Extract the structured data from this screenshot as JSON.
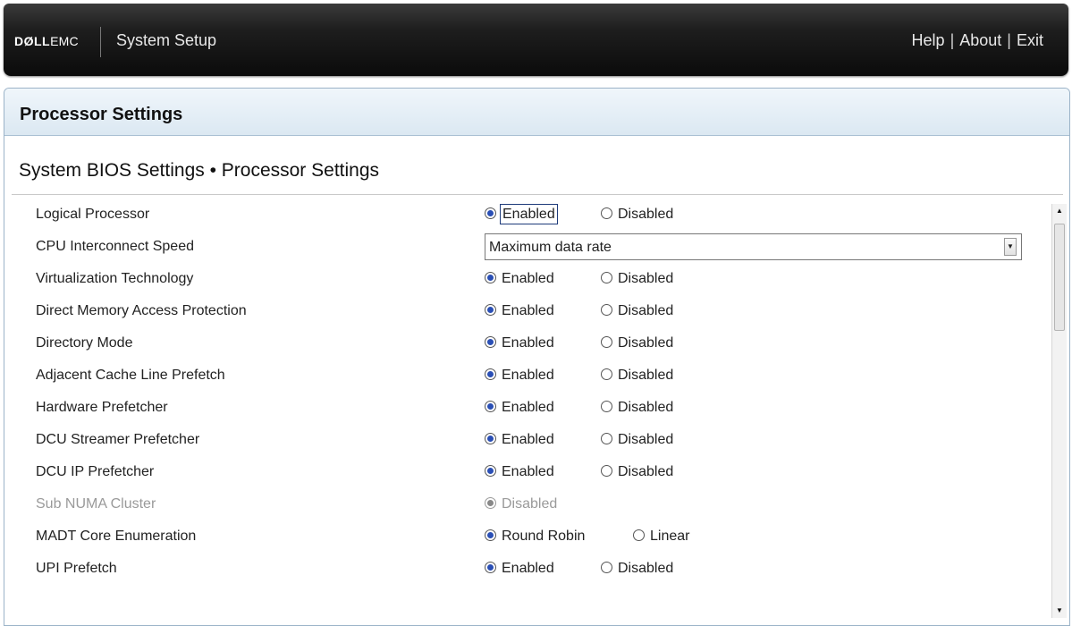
{
  "header": {
    "brand_dell": "DØLL",
    "brand_emc": "EMC",
    "app_title": "System Setup",
    "links": [
      "Help",
      "About",
      "Exit"
    ],
    "separator": "|"
  },
  "page": {
    "title": "Processor Settings",
    "breadcrumb": "System BIOS Settings • Processor Settings"
  },
  "settings": [
    {
      "label": "Logical Processor",
      "options": [
        "Enabled",
        "Disabled"
      ],
      "selected": "Enabled",
      "focused": true
    },
    {
      "label": "CPU Interconnect Speed",
      "dropdown_value": "Maximum data rate"
    },
    {
      "label": "Virtualization Technology",
      "options": [
        "Enabled",
        "Disabled"
      ],
      "selected": "Enabled"
    },
    {
      "label": "Direct Memory Access Protection",
      "options": [
        "Enabled",
        "Disabled"
      ],
      "selected": "Enabled"
    },
    {
      "label": "Directory Mode",
      "options": [
        "Enabled",
        "Disabled"
      ],
      "selected": "Enabled"
    },
    {
      "label": "Adjacent Cache Line Prefetch",
      "options": [
        "Enabled",
        "Disabled"
      ],
      "selected": "Enabled"
    },
    {
      "label": "Hardware Prefetcher",
      "options": [
        "Enabled",
        "Disabled"
      ],
      "selected": "Enabled"
    },
    {
      "label": "DCU Streamer Prefetcher",
      "options": [
        "Enabled",
        "Disabled"
      ],
      "selected": "Enabled"
    },
    {
      "label": "DCU IP Prefetcher",
      "options": [
        "Enabled",
        "Disabled"
      ],
      "selected": "Enabled"
    },
    {
      "label": "Sub NUMA Cluster",
      "options": [
        "Disabled"
      ],
      "selected": "Disabled",
      "disabled": true
    },
    {
      "label": "MADT Core Enumeration",
      "options": [
        "Round Robin",
        "Linear"
      ],
      "selected": "Round Robin"
    },
    {
      "label": "UPI Prefetch",
      "options": [
        "Enabled",
        "Disabled"
      ],
      "selected": "Enabled"
    }
  ],
  "scrollbar": {
    "up_icon": "▲",
    "down_icon": "▼"
  },
  "dropdown_arrow_icon": "▼"
}
